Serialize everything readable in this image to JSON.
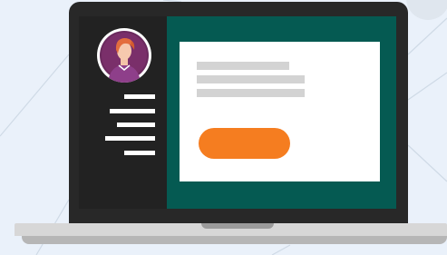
{
  "colors": {
    "background": "#eaf1fa",
    "lid": "#282828",
    "sidebar": "#222222",
    "content_area": "#055a52",
    "card": "#ffffff",
    "placeholder_text": "#d3d3d3",
    "cta_button": "#f57d20"
  },
  "sidebar": {
    "avatar_icon": "user-avatar-icon",
    "menu_items_count": 5
  },
  "card": {
    "text_lines_count": 3
  },
  "icons": [
    "user-avatar-icon",
    "hamburger-menu-lines"
  ]
}
